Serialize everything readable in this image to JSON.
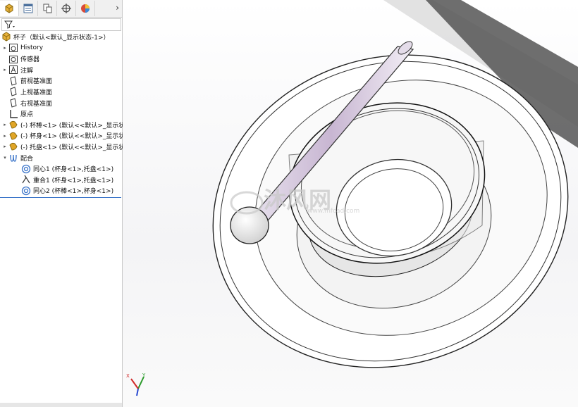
{
  "tree": {
    "root": "杯子（默认<默认_显示状态-1>）",
    "items": [
      {
        "label": "History",
        "indent": 1,
        "expand": "▸",
        "icon": "history-icon"
      },
      {
        "label": "传感器",
        "indent": 1,
        "expand": "",
        "icon": "sensor-icon"
      },
      {
        "label": "注解",
        "indent": 1,
        "expand": "▸",
        "icon": "annotation-icon"
      },
      {
        "label": "前视基准面",
        "indent": 1,
        "expand": "",
        "icon": "plane-icon"
      },
      {
        "label": "上视基准面",
        "indent": 1,
        "expand": "",
        "icon": "plane-icon"
      },
      {
        "label": "右视基准面",
        "indent": 1,
        "expand": "",
        "icon": "plane-icon"
      },
      {
        "label": "原点",
        "indent": 1,
        "expand": "",
        "icon": "origin-icon"
      },
      {
        "label": "(-) 杯棒<1> (默认<<默认>_显示状",
        "indent": 1,
        "expand": "▸",
        "icon": "part-icon"
      },
      {
        "label": "(-) 杯身<1> (默认<<默认>_显示状",
        "indent": 1,
        "expand": "▸",
        "icon": "part-icon"
      },
      {
        "label": "(-) 托盘<1> (默认<<默认>_显示状",
        "indent": 1,
        "expand": "▸",
        "icon": "part-icon"
      },
      {
        "label": "配合",
        "indent": 1,
        "expand": "▾",
        "icon": "mates-icon"
      },
      {
        "label": "同心1 (杯身<1>,托盘<1>)",
        "indent": 2,
        "expand": "",
        "icon": "concentric-icon"
      },
      {
        "label": "重合1 (杯身<1>,托盘<1>)",
        "indent": 2,
        "expand": "",
        "icon": "coincident-icon"
      },
      {
        "label": "同心2 (杯棒<1>,杯身<1>)",
        "indent": 2,
        "expand": "",
        "icon": "concentric-icon"
      }
    ]
  },
  "watermark": {
    "title": "沐风网",
    "url": "www.mfcad.com"
  },
  "colors": {
    "accent": "#3a74c9",
    "part_icon": "#e0a526"
  }
}
